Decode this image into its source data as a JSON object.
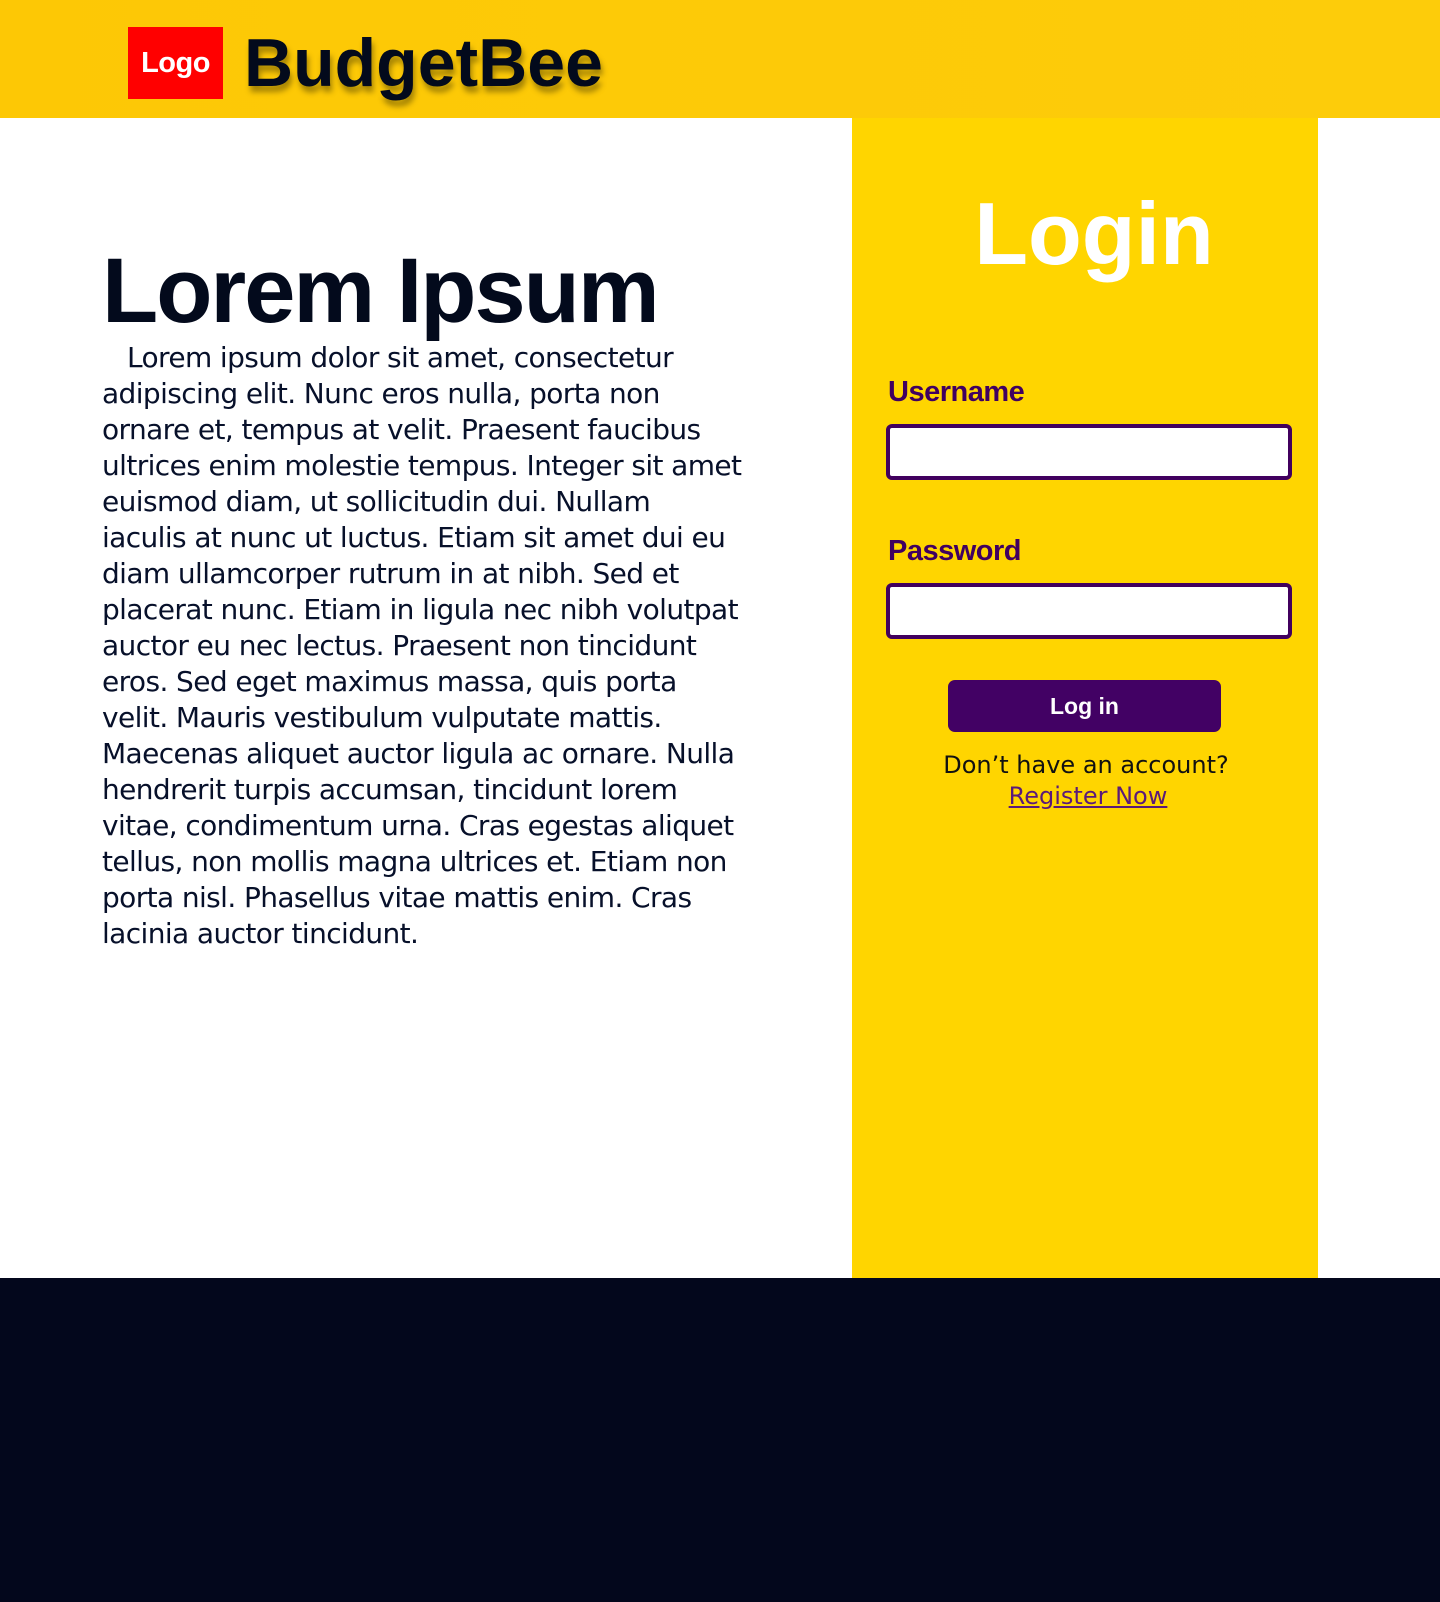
{
  "header": {
    "logo_text": "Logo",
    "brand_name": "BudgetBee"
  },
  "hero": {
    "title": "Lorem Ipsum",
    "body": "Lorem ipsum dolor sit amet, consectetur adipiscing elit. Nunc eros nulla, porta non ornare et, tempus at velit. Praesent faucibus ultrices enim molestie tempus. Integer sit amet euismod diam, ut sollicitudin dui. Nullam iaculis at nunc ut luctus. Etiam sit amet dui eu diam ullamcorper rutrum in at nibh. Sed et placerat nunc. Etiam in ligula nec nibh volutpat auctor eu nec lectus. Praesent non tincidunt eros. Sed eget maximus massa, quis porta velit. Mauris vestibulum vulputate mattis. Maecenas aliquet auctor ligula ac ornare. Nulla hendrerit turpis accumsan, tincidunt lorem vitae, condimentum urna. Cras egestas aliquet tellus, non mollis magna ultrices et. Etiam non porta nisl. Phasellus vitae mattis enim. Cras lacinia auctor tincidunt."
  },
  "login": {
    "title": "Login",
    "username_label": "Username",
    "username_value": "",
    "password_label": "Password",
    "password_value": "",
    "button_label": "Log in",
    "no_account_text": "Don’t have an account?",
    "register_link": "Register Now"
  },
  "colors": {
    "header_bg": "#fdc805",
    "logo_bg": "#ff0000",
    "panel_bg": "#ffd500",
    "accent_purple": "#420164",
    "dark_navy": "#03071c",
    "text_dark": "#030a1c"
  }
}
